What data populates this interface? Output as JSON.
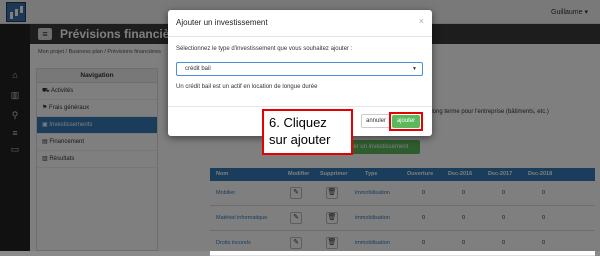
{
  "topbar": {
    "user": "Guillaume ▾"
  },
  "app": {
    "title": "Prévisions financières"
  },
  "breadcrumb": {
    "text": "Mon projet / Business plan / Prévisions financières"
  },
  "navigation": {
    "heading": "Navigation",
    "items": [
      {
        "label": "Activités",
        "icon": "cart-icon",
        "active": false
      },
      {
        "label": "Frais généraux",
        "icon": "flag-icon",
        "active": false
      },
      {
        "label": "Investissements",
        "icon": "image-icon",
        "active": true
      },
      {
        "label": "Financement",
        "icon": "money-icon",
        "active": false
      },
      {
        "label": "Résultats",
        "icon": "bar-chart-icon",
        "active": false
      }
    ]
  },
  "background": {
    "description": "le long terme pour l'entreprise (bâtiments, etc.)",
    "add_button": "Ajouter un investissement"
  },
  "table": {
    "headers": [
      "Nom",
      "Modifier",
      "Supprimer",
      "Type",
      "Ouverture",
      "Dec-2016",
      "Dec-2017",
      "Dec-2018"
    ],
    "rows": [
      {
        "name": "Mobilier",
        "type": "immobilisation",
        "ouverture": "0",
        "d2016": "0",
        "d2017": "0",
        "d2018": "0"
      },
      {
        "name": "Matériel informatique",
        "type": "immobilisation",
        "ouverture": "0",
        "d2016": "0",
        "d2017": "0",
        "d2018": "0"
      },
      {
        "name": "Droits incorels",
        "type": "immobilisation",
        "ouverture": "0",
        "d2016": "0",
        "d2017": "0",
        "d2018": "0"
      }
    ]
  },
  "modal": {
    "title": "Ajouter un investissement",
    "close": "×",
    "prompt": "Sélectionnez le type d'investissement que vous souhaitez ajouter :",
    "selected_value": "crédit bail",
    "info": "Un crédit bail est un actif en location de longue durée",
    "cancel_label": "annuler",
    "add_label": "ajouter"
  },
  "callout": {
    "line1": "6. Cliquez",
    "line2": "sur ajouter"
  },
  "colors": {
    "primary": "#337ab7",
    "success": "#5cb85c",
    "highlight": "#e60000"
  }
}
